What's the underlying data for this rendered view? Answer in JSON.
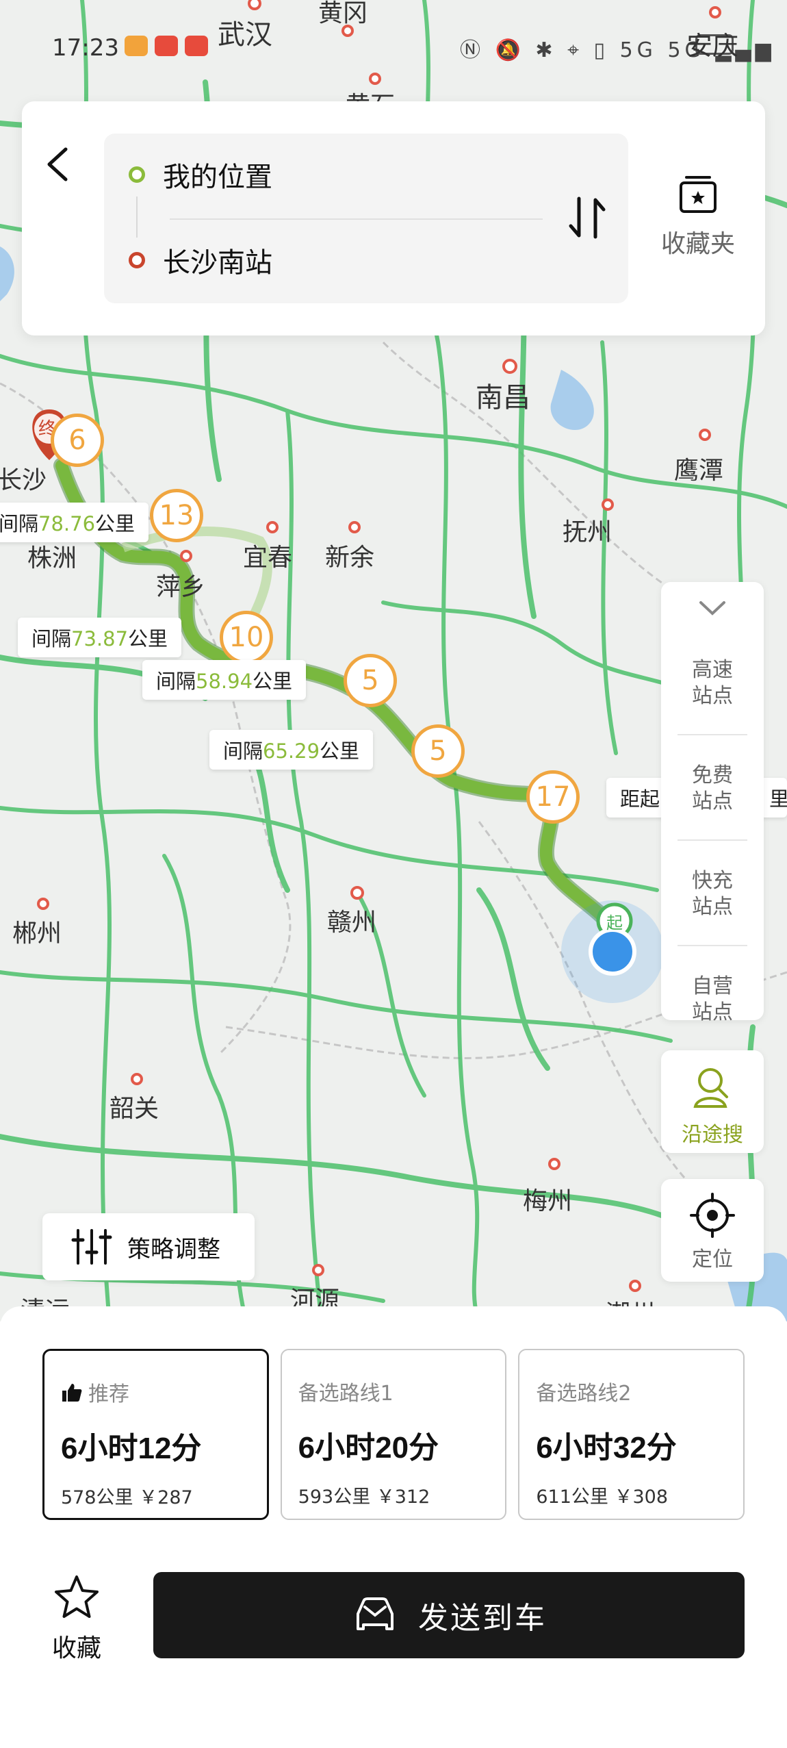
{
  "status_bar": {
    "time": "17:23",
    "network_info": "5G 5G",
    "battery_level": "安庆",
    "icons": [
      "nfc-icon",
      "bell-off-icon",
      "bluetooth-icon",
      "location-icon",
      "vibrate-icon",
      "signal-icon",
      "battery-icon"
    ]
  },
  "search": {
    "origin": "我的位置",
    "destination": "长沙南站",
    "favorites_label": "收藏夹"
  },
  "map": {
    "cities": [
      "武汉",
      "黄冈",
      "黄石",
      "南昌",
      "鹰潭",
      "抚州",
      "宜春",
      "新余",
      "萍乡",
      "长沙",
      "株洲",
      "赣州",
      "郴州",
      "韶关",
      "梅州",
      "河源",
      "清远",
      "潮州"
    ],
    "start_marker": "起",
    "end_marker": "终",
    "segments": [
      {
        "prefix": "间隔",
        "value": "78.76",
        "unit": "公里"
      },
      {
        "prefix": "间隔",
        "value": "73.87",
        "unit": "公里"
      },
      {
        "prefix": "间隔",
        "value": "58.94",
        "unit": "公里"
      },
      {
        "prefix": "间隔",
        "value": "65.29",
        "unit": "公里"
      },
      {
        "prefix": "距起",
        "value": "",
        "unit": "里"
      }
    ],
    "station_counts": [
      "6",
      "13",
      "10",
      "5",
      "5",
      "17"
    ]
  },
  "side_panel": {
    "items": [
      "高速\n站点",
      "免费\n站点",
      "快充\n站点",
      "自营\n站点"
    ],
    "along_search": "沿途搜",
    "locate": "定位"
  },
  "strategy_label": "策略调整",
  "routes": [
    {
      "tag": "推荐",
      "duration": "6小时12分",
      "distance": "578公里",
      "price": "￥287",
      "selected": true
    },
    {
      "tag": "备选路线1",
      "duration": "6小时20分",
      "distance": "593公里",
      "price": "￥312",
      "selected": false
    },
    {
      "tag": "备选路线2",
      "duration": "6小时32分",
      "distance": "611公里",
      "price": "￥308",
      "selected": false
    }
  ],
  "actions": {
    "collect": "收藏",
    "send_to_car": "发送到车"
  },
  "colors": {
    "route_green": "#79b83f",
    "road_green": "#4cc16b",
    "marker_orange": "#f0a640",
    "accent_green": "#8bbb3b",
    "end_red": "#c9452d",
    "location_blue": "#3a93e8"
  }
}
